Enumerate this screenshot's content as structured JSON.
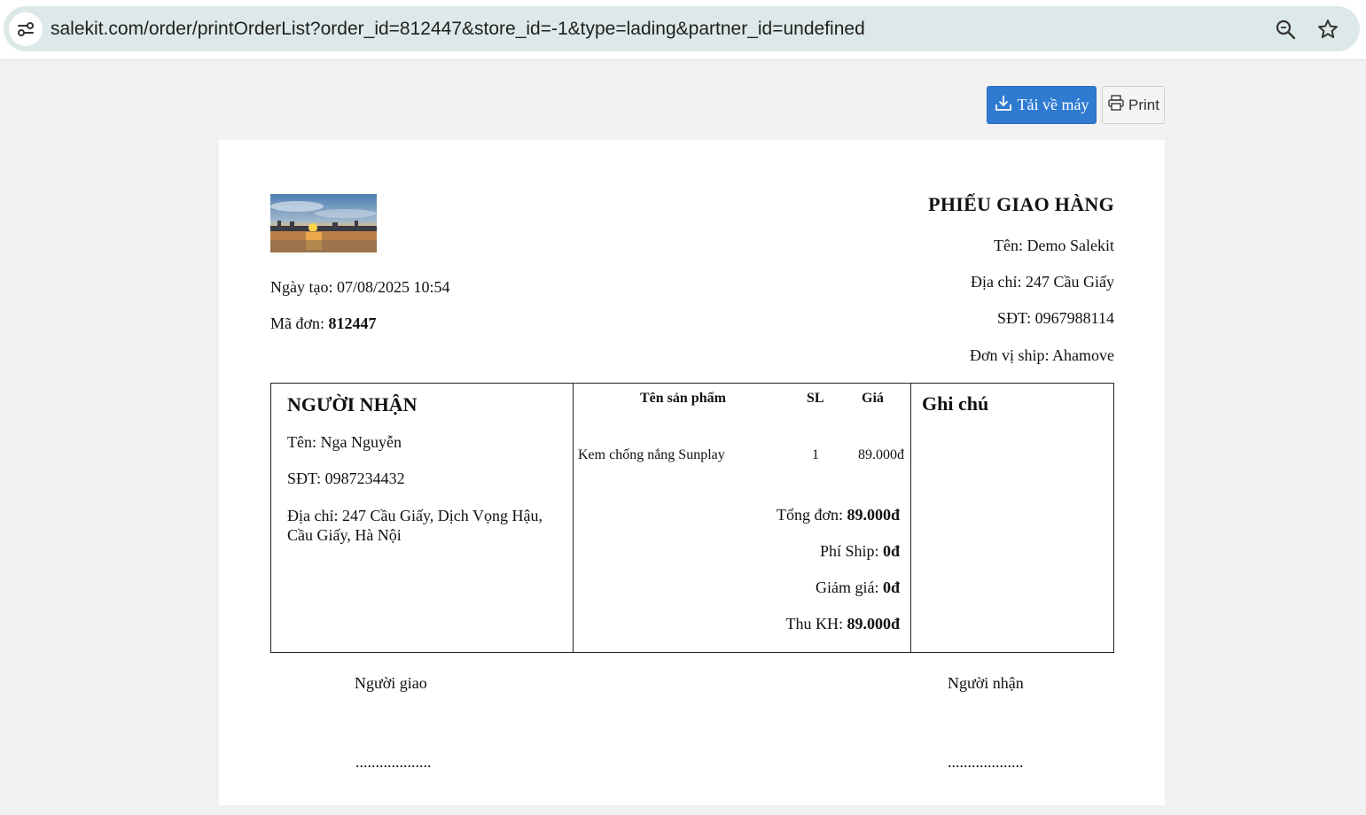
{
  "browser": {
    "url": "salekit.com/order/printOrderList?order_id=812447&store_id=-1&type=lading&partner_id=undefined",
    "icons": [
      "site-info-icon",
      "zoom-icon",
      "bookmark-star-icon"
    ]
  },
  "toolbar": {
    "download_label": "Tải về máy",
    "print_label": "Print",
    "download_color": "#2f7bd1"
  },
  "header": {
    "title": "PHIẾU GIAO HÀNG",
    "created": "Ngày tạo: 07/08/2025 10:54",
    "order_label": "Mã đơn: ",
    "order_id": "812447",
    "shop_name": "Tên: Demo Salekit",
    "shop_address": "Địa chỉ: 247 Cầu Giấy",
    "shop_phone": "SĐT: 0967988114",
    "shipping": "Đơn vị ship: Ahamove"
  },
  "receiver": {
    "heading": "NGƯỜI NHẬN",
    "name": "Tên: Nga Nguyễn",
    "phone": "SĐT: 0987234432",
    "address": "Địa chỉ: 247 Cầu Giấy, Dịch Vọng Hậu, Cầu Giấy, Hà Nội"
  },
  "products": {
    "columns": [
      "Tên sản phẩm",
      "SL",
      "Giá"
    ],
    "rows": [
      {
        "name": "Kem chống nắng Sunplay",
        "qty": "1",
        "price": "89.000đ"
      }
    ]
  },
  "summary": {
    "total_label": "Tổng đơn: ",
    "total": "89.000đ",
    "ship_label": "Phí Ship: ",
    "ship": "0đ",
    "discount_label": "Giảm giá: ",
    "discount": "0đ",
    "collect_label": "Thu KH: ",
    "collect": "89.000đ"
  },
  "note": {
    "heading": "Ghi chú"
  },
  "signatures": {
    "deliverer": "Người giao",
    "recipient": "Người nhận",
    "line": "..................."
  }
}
